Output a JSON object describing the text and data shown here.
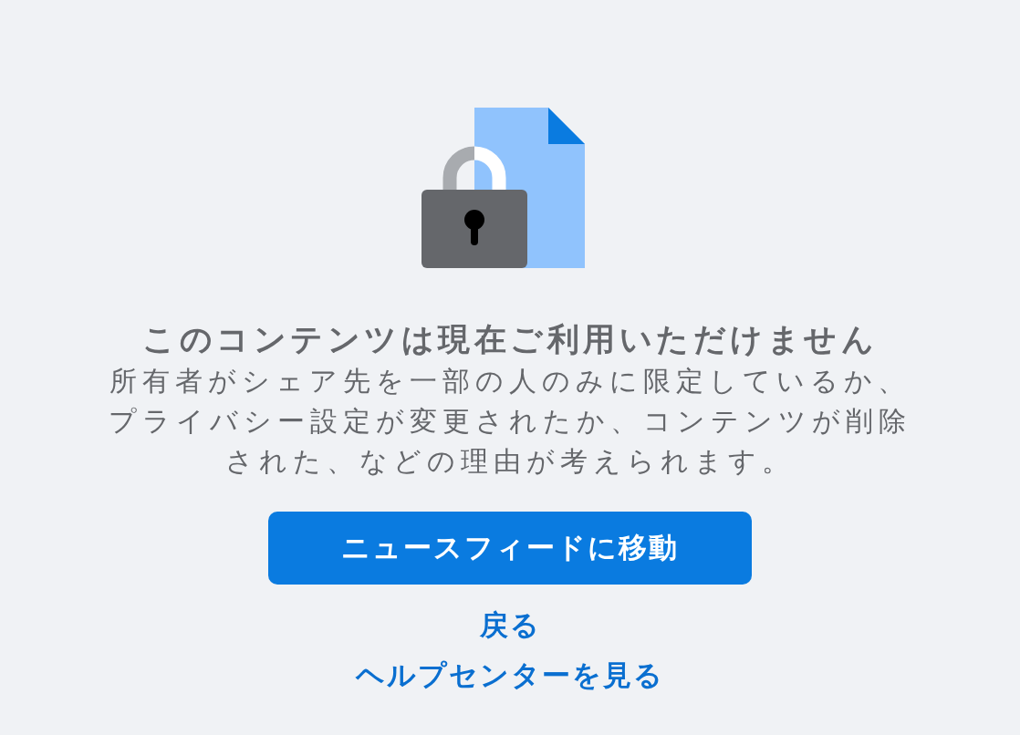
{
  "title": "このコンテンツは現在ご利用いただけません",
  "message": "所有者がシェア先を一部の人のみに限定しているか、プライバシー設定が変更されたか、コンテンツが削除された、などの理由が考えられます。",
  "primary_button": "ニュースフィードに移動",
  "links": [
    "戻る",
    "ヘルプセンターを見る"
  ]
}
